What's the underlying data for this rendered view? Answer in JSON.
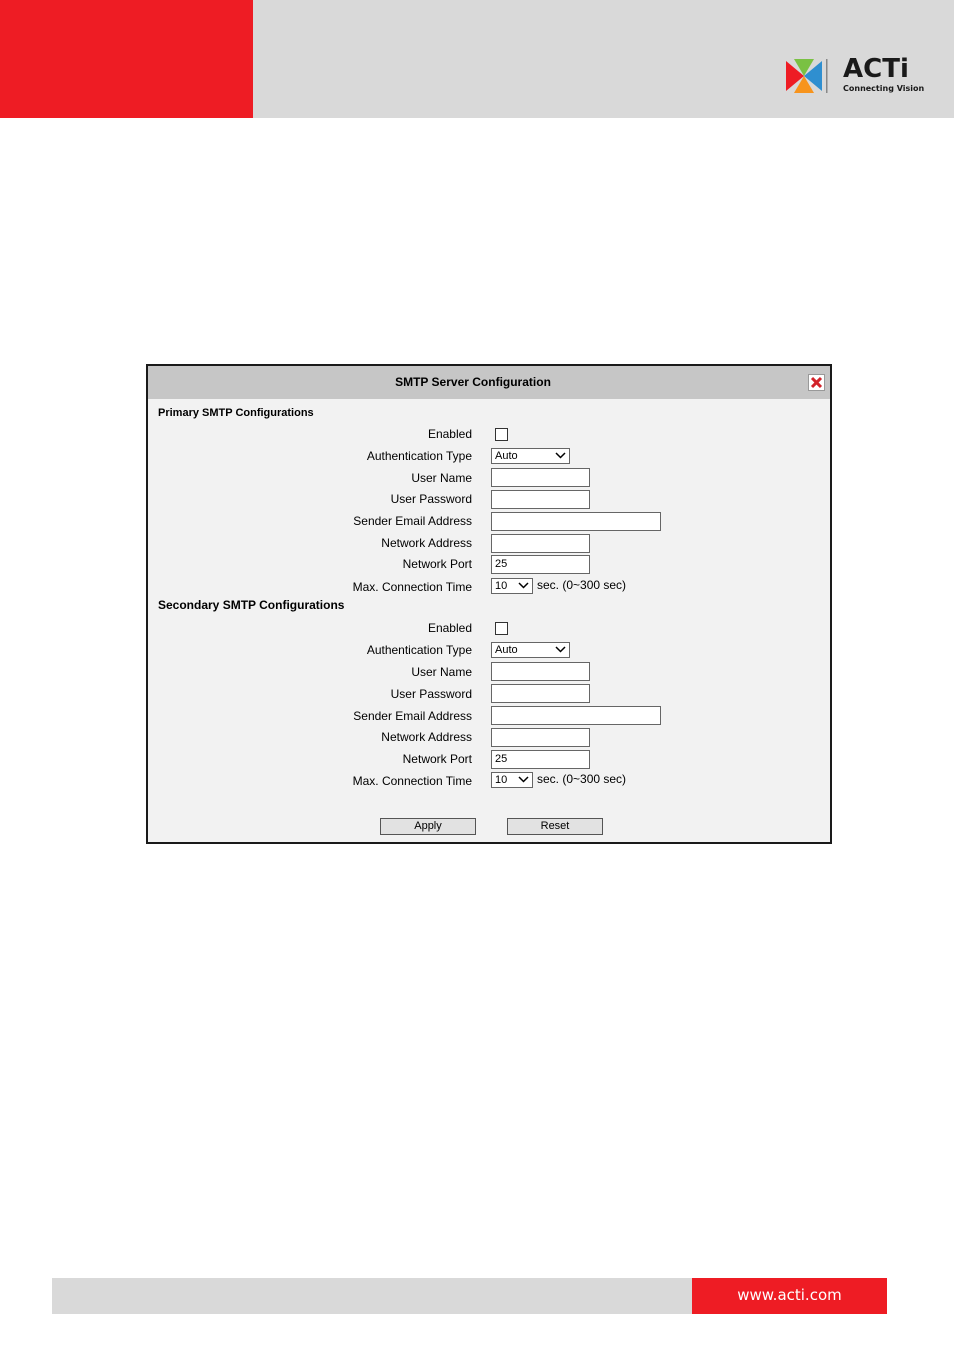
{
  "header": {
    "comma": ",",
    "logo_word": "ACTi",
    "logo_tagline": "Connecting Vision"
  },
  "dialog": {
    "title": "SMTP Server Configuration",
    "close_icon": "close-x-icon",
    "primary": {
      "heading": "Primary SMTP Configurations",
      "enabled_label": "Enabled",
      "auth_label": "Authentication Type",
      "auth_value": "Auto",
      "user_label": "User Name",
      "user_value": "",
      "password_label": "User Password",
      "password_value": "",
      "sender_label": "Sender Email Address",
      "sender_value": "",
      "address_label": "Network Address",
      "address_value": "",
      "port_label": "Network Port",
      "port_value": "25",
      "time_label": "Max. Connection Time",
      "time_value": "10",
      "time_unit": "sec. (0~300 sec)"
    },
    "secondary": {
      "heading": "Secondary SMTP Configurations",
      "enabled_label": "Enabled",
      "auth_label": "Authentication Type",
      "auth_value": "Auto",
      "user_label": "User Name",
      "user_value": "",
      "password_label": "User Password",
      "password_value": "",
      "sender_label": "Sender Email Address",
      "sender_value": "",
      "address_label": "Network Address",
      "address_value": "",
      "port_label": "Network Port",
      "port_value": "25",
      "time_label": "Max. Connection Time",
      "time_value": "10",
      "time_unit": "sec. (0~300 sec)"
    },
    "apply_label": "Apply",
    "reset_label": "Reset"
  },
  "footer": {
    "url": "www.acti.com"
  },
  "colors": {
    "brand_red": "#ee1c24",
    "band_gray": "#d9d9d9",
    "dialog_bg": "#f2f2f2",
    "titlebar": "#c6c6c6"
  }
}
